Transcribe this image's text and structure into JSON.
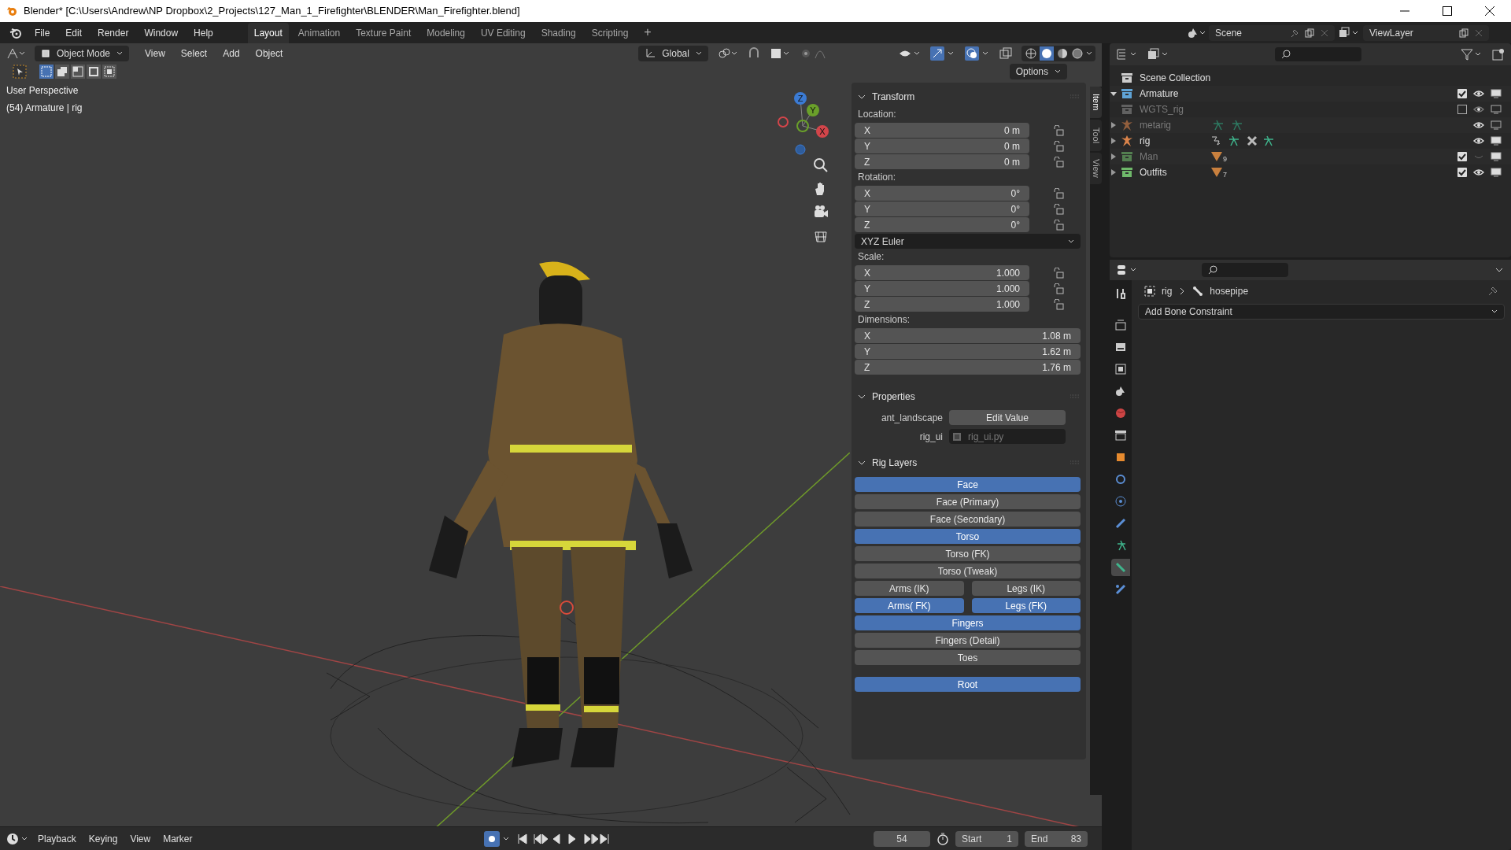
{
  "window": {
    "title": "Blender* [C:\\Users\\Andrew\\NP Dropbox\\2_Projects\\127_Man_1_Firefighter\\BLENDER\\Man_Firefighter.blend]"
  },
  "menu_bar": [
    "File",
    "Edit",
    "Render",
    "Window",
    "Help"
  ],
  "workspace_tabs": [
    {
      "label": "Layout",
      "selected": true
    },
    {
      "label": "Animation",
      "selected": false
    },
    {
      "label": "Texture Paint",
      "selected": false
    },
    {
      "label": "Modeling",
      "selected": false
    },
    {
      "label": "UV Editing",
      "selected": false
    },
    {
      "label": "Shading",
      "selected": false
    },
    {
      "label": "Scripting",
      "selected": false
    }
  ],
  "add_workspace": "+",
  "scene": {
    "name": "Scene",
    "view_layer": "ViewLayer"
  },
  "viewport_header": {
    "mode": "Object Mode",
    "menus": [
      "View",
      "Select",
      "Add",
      "Object"
    ],
    "orientation": "Global",
    "options": "Options"
  },
  "viewport": {
    "info": [
      "User Perspective",
      "(54) Armature | rig"
    ],
    "gizmo_axes": [
      "Z",
      "Y",
      "X"
    ]
  },
  "sidebar_tabs": [
    {
      "label": "Item",
      "selected": true
    },
    {
      "label": "Tool",
      "selected": false
    },
    {
      "label": "View",
      "selected": false
    }
  ],
  "transform": {
    "title": "Transform",
    "expanded": true,
    "groups": [
      {
        "label": "Location:",
        "lock": true,
        "fields": [
          {
            "axis": "X",
            "value": "0 m"
          },
          {
            "axis": "Y",
            "value": "0 m"
          },
          {
            "axis": "Z",
            "value": "0 m"
          }
        ]
      },
      {
        "label": "Rotation:",
        "lock": true,
        "fields": [
          {
            "axis": "X",
            "value": "0°"
          },
          {
            "axis": "Y",
            "value": "0°"
          },
          {
            "axis": "Z",
            "value": "0°"
          }
        ],
        "mode": "XYZ Euler"
      },
      {
        "label": "Scale:",
        "lock": true,
        "fields": [
          {
            "axis": "X",
            "value": "1.000"
          },
          {
            "axis": "Y",
            "value": "1.000"
          },
          {
            "axis": "Z",
            "value": "1.000"
          }
        ]
      },
      {
        "label": "Dimensions:",
        "lock": false,
        "fields": [
          {
            "axis": "X",
            "value": "1.08 m"
          },
          {
            "axis": "Y",
            "value": "1.62 m"
          },
          {
            "axis": "Z",
            "value": "1.76 m"
          }
        ]
      }
    ]
  },
  "properties": {
    "title": "Properties",
    "expanded": true,
    "items": [
      {
        "label": "ant_landscape",
        "kind": "button",
        "value": "Edit Value"
      },
      {
        "label": "rig_ui",
        "kind": "file",
        "value": "rig_ui.py"
      }
    ]
  },
  "rig_layers": {
    "title": "Rig Layers",
    "expanded": true,
    "rows": [
      [
        {
          "label": "Face",
          "on": true
        }
      ],
      [
        {
          "label": "Face (Primary)",
          "on": false
        }
      ],
      [
        {
          "label": "Face (Secondary)",
          "on": false
        }
      ],
      [
        {
          "label": "Torso",
          "on": true
        }
      ],
      [
        {
          "label": "Torso (FK)",
          "on": false
        }
      ],
      [
        {
          "label": "Torso (Tweak)",
          "on": false
        }
      ],
      [
        {
          "label": "Arms (IK)",
          "on": false
        },
        {
          "label": "Legs (IK)",
          "on": false
        }
      ],
      [
        {
          "label": "Arms( FK)",
          "on": true
        },
        {
          "label": "Legs (FK)",
          "on": true
        }
      ],
      [
        {
          "label": "Fingers",
          "on": true
        }
      ],
      [
        {
          "label": "Fingers (Detail)",
          "on": false
        }
      ],
      [
        {
          "label": "Toes",
          "on": false
        }
      ],
      [
        {
          "label": "Root",
          "on": true
        }
      ]
    ]
  },
  "outliner": {
    "tree": [
      {
        "label": "Scene Collection",
        "kind": "scene",
        "children": [
          {
            "label": "Armature",
            "kind": "collection",
            "expanded": true,
            "enabled": true,
            "checked": true,
            "visible": true,
            "children": [
              {
                "label": "WGTS_rig",
                "kind": "collection",
                "enabled": false,
                "checked": false,
                "visible": true
              },
              {
                "label": "metarig",
                "kind": "armature",
                "expanded": false,
                "enabled": false,
                "visible": true
              },
              {
                "label": "rig",
                "kind": "armature",
                "expanded": false,
                "enabled": true,
                "visible": true
              }
            ]
          },
          {
            "label": "Man",
            "kind": "collection",
            "expanded": false,
            "enabled": false,
            "checked": true,
            "visible": false,
            "count": "9"
          },
          {
            "label": "Outfits",
            "kind": "collection",
            "expanded": false,
            "enabled": true,
            "checked": true,
            "visible": true,
            "count": "7"
          }
        ]
      }
    ]
  },
  "properties_editor": {
    "breadcrumb": [
      "rig",
      "hosepipe"
    ],
    "dropdown": "Add Bone Constraint",
    "tabs": [
      {
        "selected": false
      },
      {
        "selected": false
      },
      {
        "selected": false
      },
      {
        "selected": false
      },
      {
        "selected": false
      },
      {
        "selected": false
      },
      {
        "selected": false
      },
      {
        "selected": false
      },
      {
        "selected": false
      },
      {
        "selected": false
      },
      {
        "selected": false
      },
      {
        "selected": false
      },
      {
        "selected": true
      },
      {
        "selected": false
      }
    ]
  },
  "timeline": {
    "menus": [
      "Playback",
      "Keying",
      "View",
      "Marker"
    ],
    "current_frame": "54",
    "start_label": "Start",
    "start": "1",
    "end_label": "End",
    "end": "83"
  }
}
